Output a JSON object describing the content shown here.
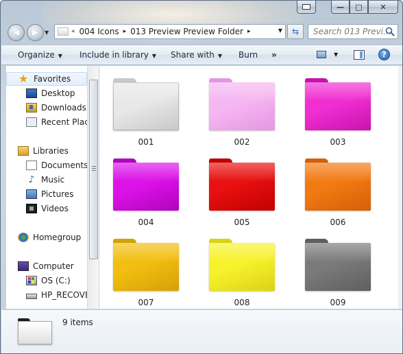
{
  "window": {
    "minimize": "—",
    "maximize": "□",
    "close": "✕"
  },
  "nav": {
    "back": "◀",
    "forward": "▶",
    "breadcrumb": [
      "004 Icons",
      "013 Preview Preview Folder"
    ],
    "breadcrumb_lead": "«",
    "separator": "▸",
    "refresh": "⇆",
    "search_placeholder": "Search 013 Previ..."
  },
  "commands": {
    "organize": "Organize",
    "include": "Include in library",
    "share": "Share with",
    "burn": "Burn",
    "more": "»",
    "help": "?"
  },
  "navpane": {
    "favorites": "Favorites",
    "desktop": "Desktop",
    "downloads": "Downloads",
    "recent": "Recent Places",
    "libraries": "Libraries",
    "documents": "Documents",
    "music": "Music",
    "pictures": "Pictures",
    "videos": "Videos",
    "homegroup": "Homegroup",
    "computer": "Computer",
    "os": "OS (C:)",
    "recovery": "HP_RECOVERY"
  },
  "folders": [
    {
      "label": "001",
      "color": "#e8e8e8",
      "dark": "#c9c9c9"
    },
    {
      "label": "002",
      "color": "#f6b6f2",
      "dark": "#e497e0"
    },
    {
      "label": "003",
      "color": "#f02ed2",
      "dark": "#c913ae"
    },
    {
      "label": "004",
      "color": "#dc12e8",
      "dark": "#b003bd"
    },
    {
      "label": "005",
      "color": "#e81010",
      "dark": "#c00000"
    },
    {
      "label": "006",
      "color": "#f27a12",
      "dark": "#d3600a"
    },
    {
      "label": "007",
      "color": "#f2be10",
      "dark": "#d3a108"
    },
    {
      "label": "008",
      "color": "#f7f22c",
      "dark": "#dbd316"
    },
    {
      "label": "009",
      "color": "#7a7a7a",
      "dark": "#5f5f5f"
    }
  ],
  "details": {
    "count": "9 items"
  }
}
